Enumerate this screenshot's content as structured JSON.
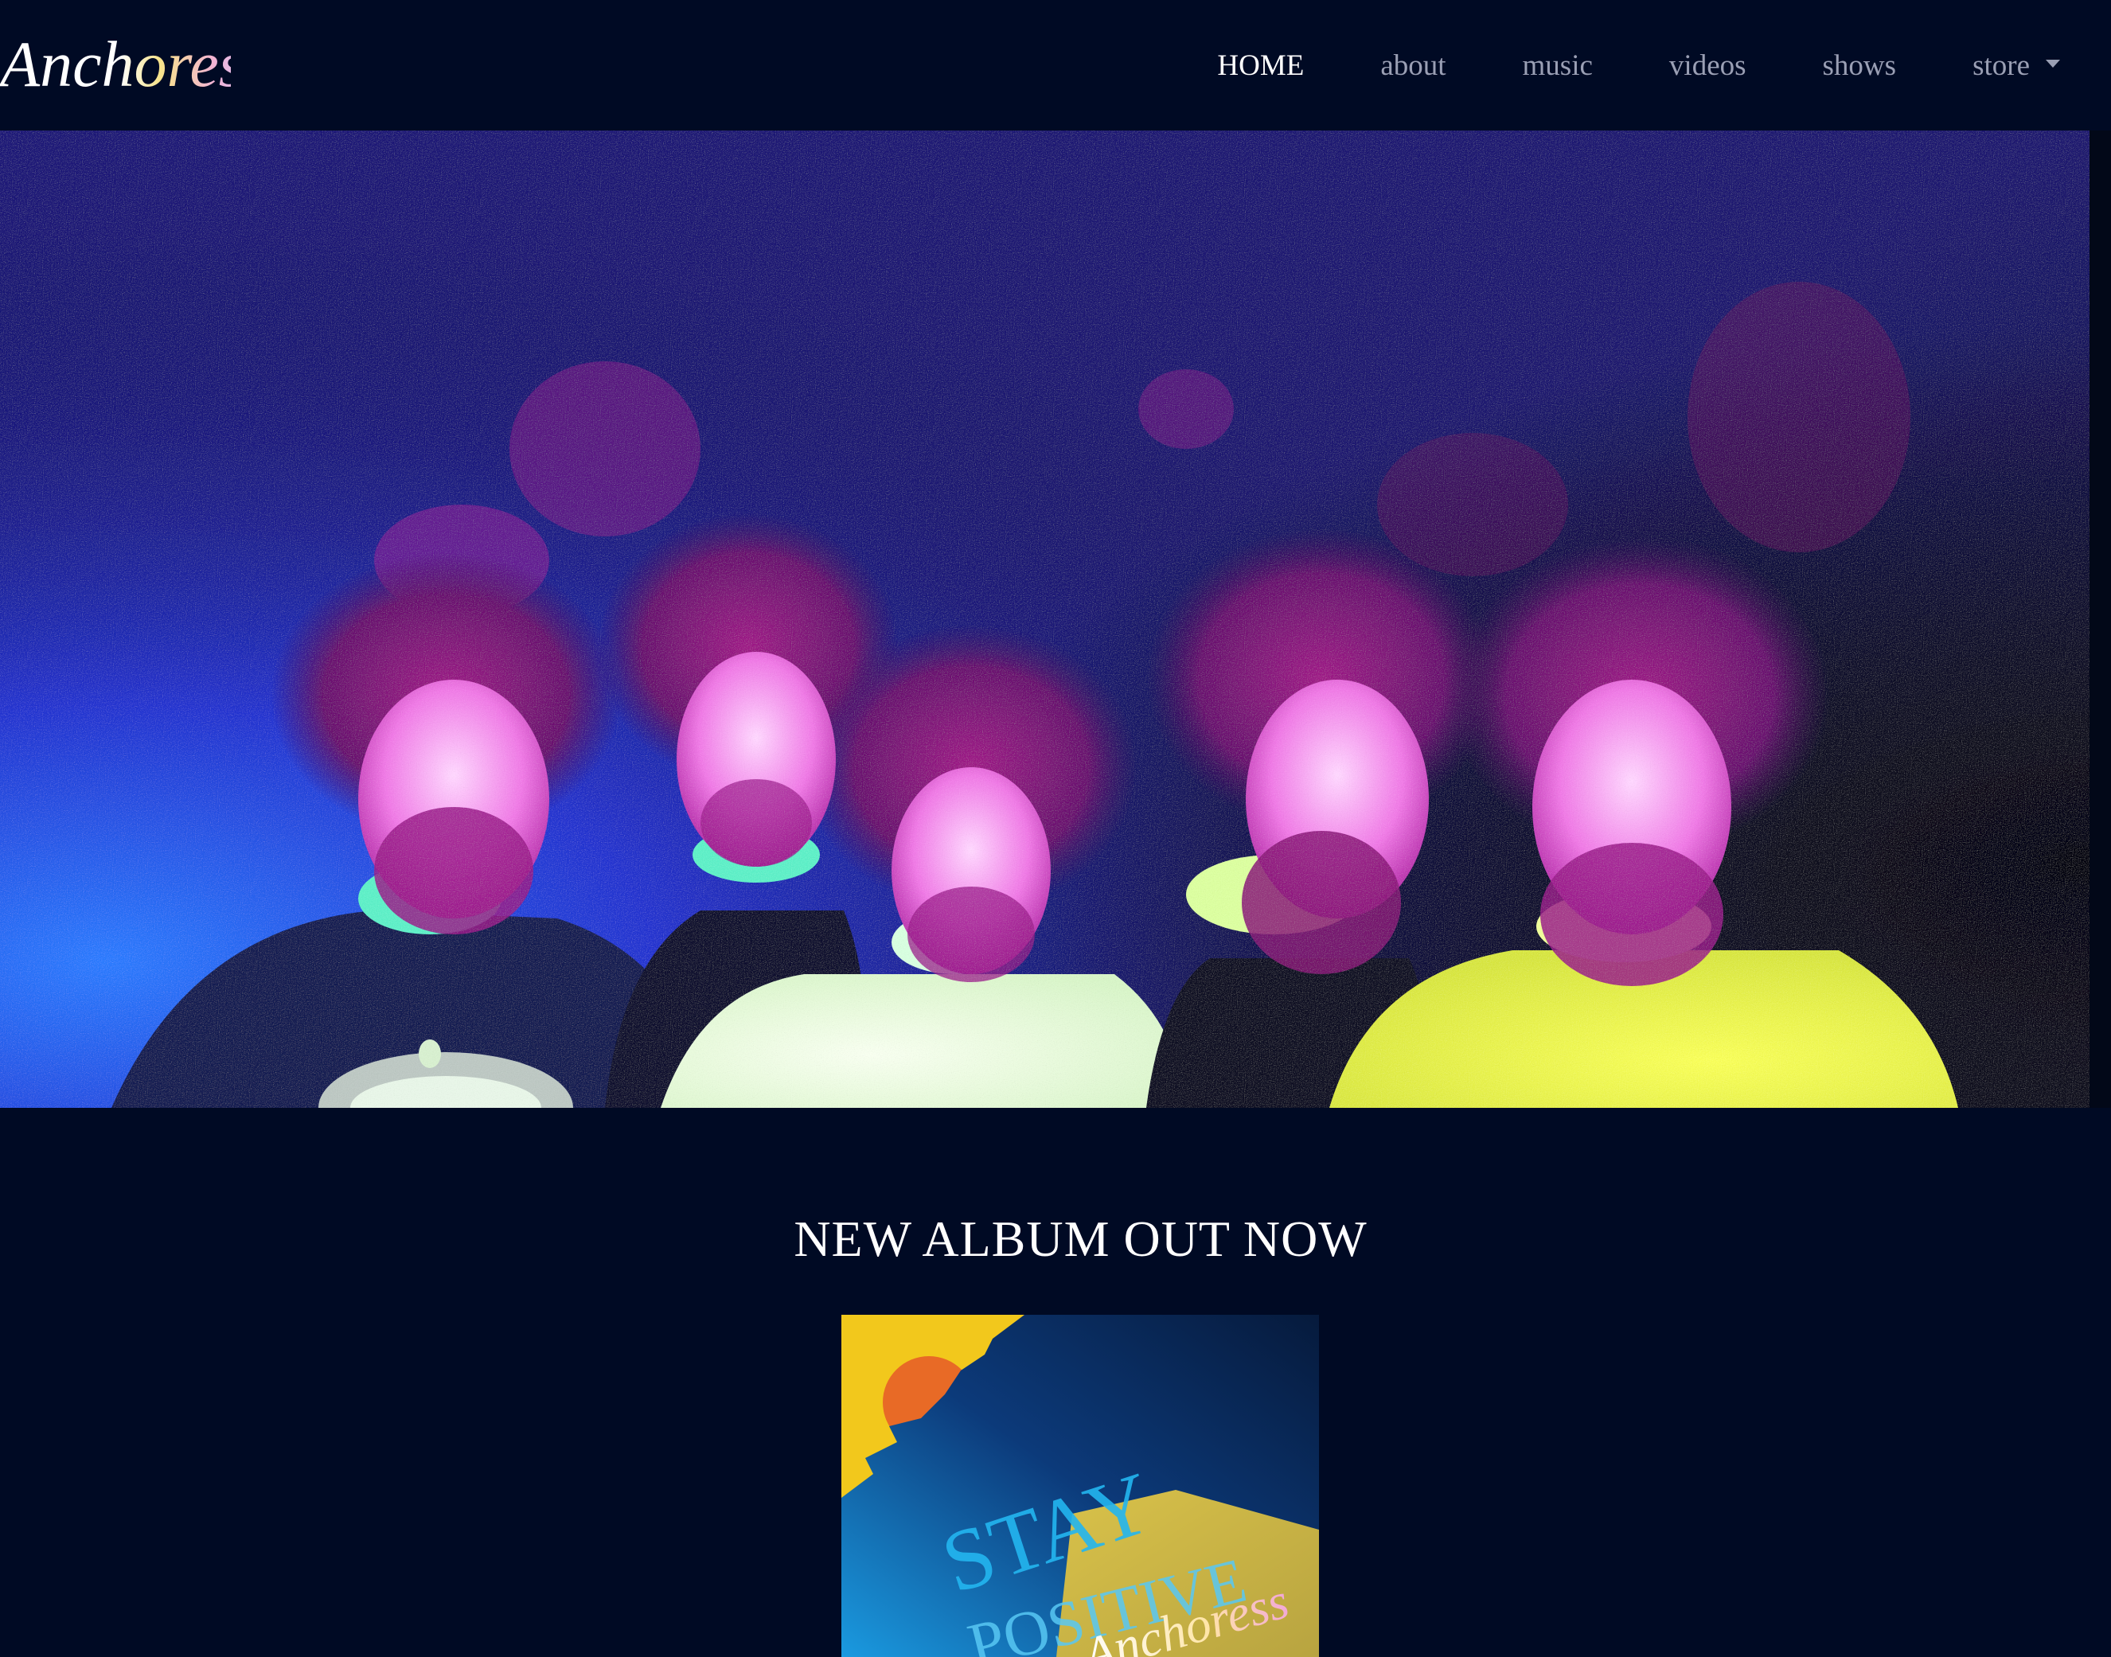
{
  "site": {
    "brand_name": "Anchoress",
    "colors": {
      "background": "#000a24",
      "nav_text": "#9a9fb4",
      "nav_active": "#ffffff",
      "heading": "#ffffff"
    }
  },
  "nav": {
    "items": [
      {
        "label": "HOME",
        "active": true
      },
      {
        "label": "about",
        "active": false
      },
      {
        "label": "music",
        "active": false
      },
      {
        "label": "videos",
        "active": false
      },
      {
        "label": "shows",
        "active": false
      },
      {
        "label": "store",
        "active": false,
        "dropdown": true
      }
    ]
  },
  "hero": {
    "image": "band-photo"
  },
  "feature": {
    "heading": "NEW ALBUM OUT NOW",
    "album": {
      "image": "album-cover",
      "cover_text_1": "STAY",
      "cover_text_2": "POSITIVE",
      "cover_brand": "Anchoress"
    }
  }
}
